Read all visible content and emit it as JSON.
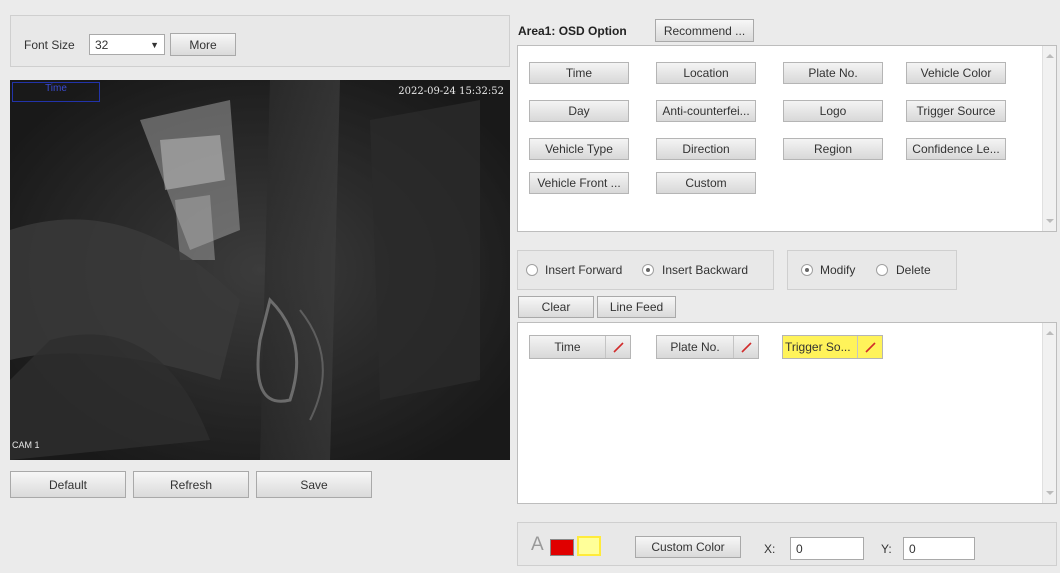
{
  "font_size": {
    "label": "Font Size",
    "value": "32",
    "more_button": "More"
  },
  "video": {
    "overlay_box_label": "Time",
    "timestamp": "2022-09-24 15:32:52",
    "channel_label": "CAM 1"
  },
  "bottom_buttons": {
    "default": "Default",
    "refresh": "Refresh",
    "save": "Save"
  },
  "osd": {
    "area_title": "Area1: OSD Option",
    "recommend_button": "Recommend ...",
    "options": [
      "Time",
      "Location",
      "Plate No.",
      "Vehicle Color",
      "Day",
      "Anti-counterfei...",
      "Logo",
      "Trigger Source",
      "Vehicle Type",
      "Direction",
      "Region",
      "Confidence Le...",
      "Vehicle Front ...",
      "Custom"
    ]
  },
  "insert_mode": {
    "forward": "Insert Forward",
    "backward": "Insert Backward",
    "selected": "backward"
  },
  "edit_mode": {
    "modify": "Modify",
    "delete": "Delete",
    "selected": "modify"
  },
  "actions": {
    "clear": "Clear",
    "line_feed": "Line Feed"
  },
  "selected_items": [
    {
      "label": "Time",
      "highlighted": false
    },
    {
      "label": "Plate No.",
      "highlighted": false
    },
    {
      "label": "Trigger So...",
      "highlighted": true
    }
  ],
  "color_bar": {
    "font_color_letter": "A",
    "swatch_red": "#e00000",
    "swatch_yellow": "#ffff66",
    "custom_color_button": "Custom Color",
    "x_label": "X:",
    "x_value": "0",
    "y_label": "Y:",
    "y_value": "0"
  }
}
